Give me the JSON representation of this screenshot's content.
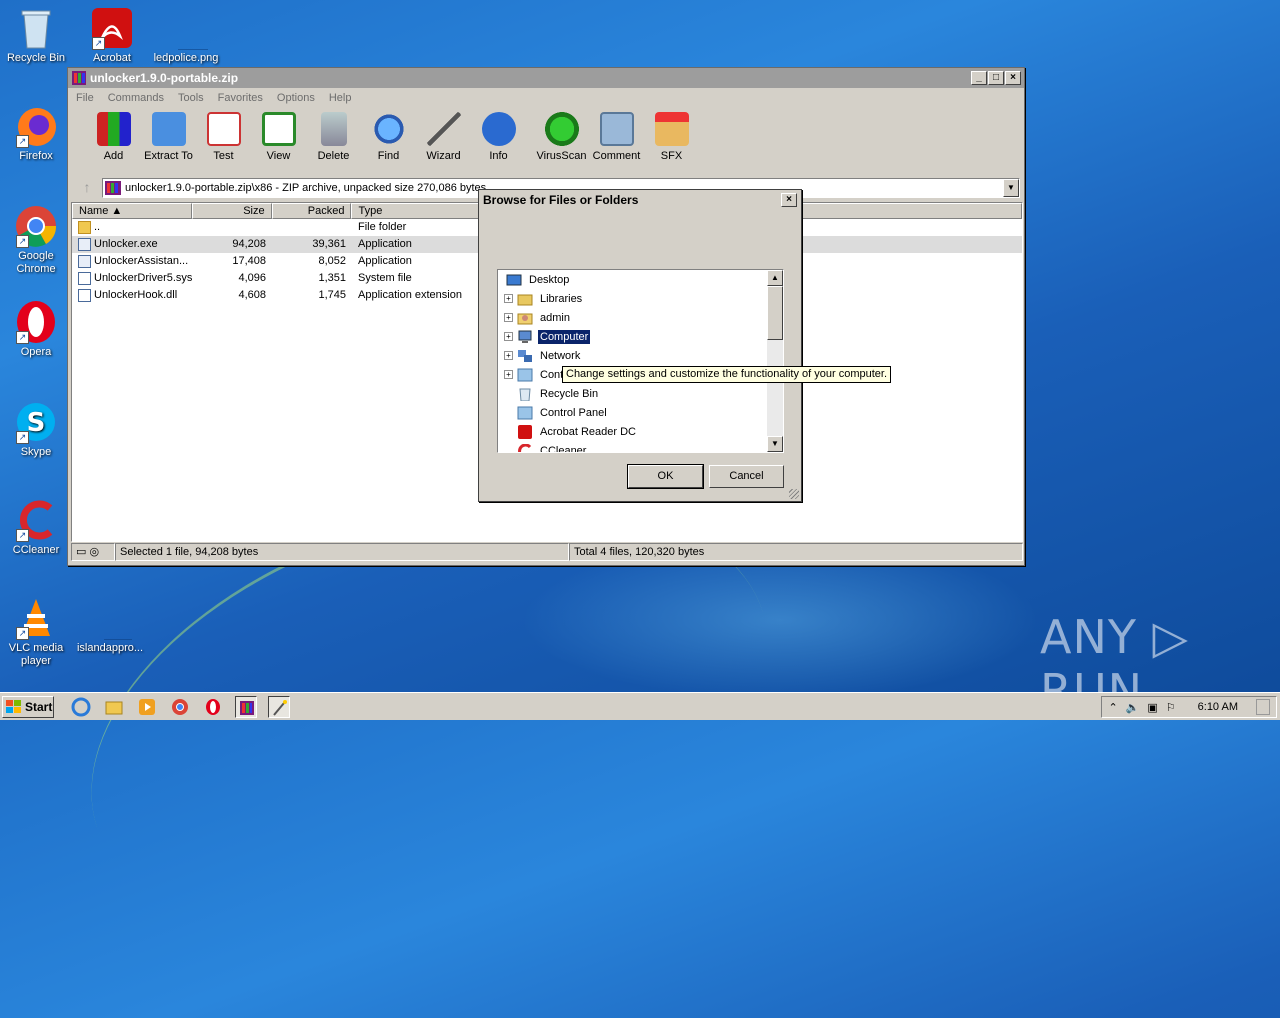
{
  "desktop": {
    "icons": [
      {
        "label": "Recycle Bin"
      },
      {
        "label": "Acrobat"
      },
      {
        "label": "ledpolice.png"
      },
      {
        "label": "Firefox"
      },
      {
        "label": "Google Chrome"
      },
      {
        "label": "Opera"
      },
      {
        "label": "Skype"
      },
      {
        "label": "CCleaner"
      },
      {
        "label": "VLC media player"
      },
      {
        "label": "islandappro..."
      }
    ],
    "watermark": "ANY ▷ RUN"
  },
  "window": {
    "title": "unlocker1.9.0-portable.zip",
    "controls": {
      "minimize": "_",
      "maximize": "□",
      "close": "×"
    },
    "menu": [
      "File",
      "Commands",
      "Tools",
      "Favorites",
      "Options",
      "Help"
    ],
    "toolbar": [
      "Add",
      "Extract To",
      "Test",
      "View",
      "Delete",
      "Find",
      "Wizard",
      "Info",
      "VirusScan",
      "Comment",
      "SFX"
    ],
    "address": "unlocker1.9.0-portable.zip\\x86 - ZIP archive, unpacked size 270,086 bytes",
    "columns": {
      "name": "Name",
      "size": "Size",
      "packed": "Packed",
      "type": "Type"
    },
    "files": [
      {
        "name": "..",
        "size": "",
        "packed": "",
        "type": "File folder"
      },
      {
        "name": "Unlocker.exe",
        "size": "94,208",
        "packed": "39,361",
        "type": "Application"
      },
      {
        "name": "UnlockerAssistan...",
        "size": "17,408",
        "packed": "8,052",
        "type": "Application"
      },
      {
        "name": "UnlockerDriver5.sys",
        "size": "4,096",
        "packed": "1,351",
        "type": "System file"
      },
      {
        "name": "UnlockerHook.dll",
        "size": "4,608",
        "packed": "1,745",
        "type": "Application extension"
      }
    ],
    "status_left": "Selected 1 file, 94,208 bytes",
    "status_right": "Total 4 files, 120,320 bytes"
  },
  "dialog": {
    "title": "Browse for Files or Folders",
    "close": "×",
    "tree": [
      {
        "label": "Desktop"
      },
      {
        "label": "Libraries"
      },
      {
        "label": "admin"
      },
      {
        "label": "Computer"
      },
      {
        "label": "Network"
      },
      {
        "label": "Control Panel"
      },
      {
        "label": "Recycle Bin"
      },
      {
        "label": "Control Panel"
      },
      {
        "label": "Acrobat Reader DC"
      },
      {
        "label": "CCleaner"
      }
    ],
    "tooltip": "Change settings and customize the functionality of your computer.",
    "ok": "OK",
    "cancel": "Cancel"
  },
  "taskbar": {
    "start": "Start",
    "clock": "6:10 AM"
  }
}
